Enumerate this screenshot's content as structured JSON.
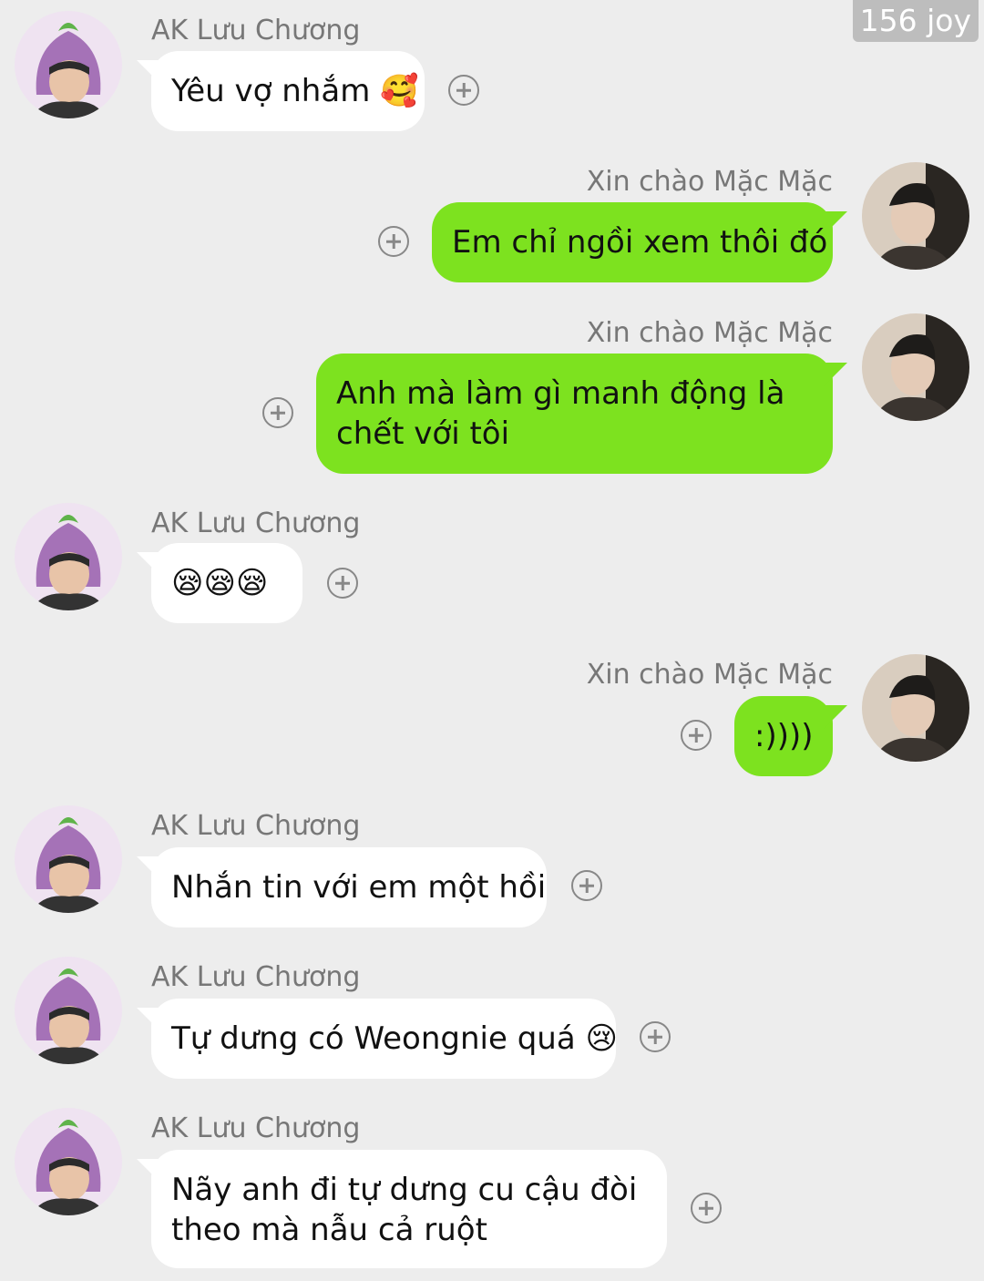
{
  "badge": {
    "label": "156 joy"
  },
  "colors": {
    "background": "#ededed",
    "outgoing_bubble": "#7de21f",
    "incoming_bubble": "#ffffff"
  },
  "contacts": {
    "them": {
      "name": "AK Lưu Chương",
      "avatar_icon": "eggplant-hat-avatar-icon"
    },
    "me": {
      "name": "Xin chào Mặc Mặc",
      "avatar_icon": "person-portrait-avatar-icon"
    }
  },
  "messages": [
    {
      "sender": "AK Lưu Chương",
      "text": "Yêu vợ nhắm 🥰",
      "direction": "incoming"
    },
    {
      "sender": "Xin chào Mặc Mặc",
      "text": "Em chỉ ngồi xem thôi đó",
      "direction": "outgoing"
    },
    {
      "sender": "Xin chào Mặc Mặc",
      "text": "Anh mà làm gì manh động là",
      "text2": "chết với tôi",
      "direction": "outgoing"
    },
    {
      "sender": "AK Lưu Chương",
      "text": "😪😪😪",
      "direction": "incoming"
    },
    {
      "sender": "Xin chào Mặc Mặc",
      "text": ":))))",
      "direction": "outgoing"
    },
    {
      "sender": "AK Lưu Chương",
      "text": "Nhắn tin với em một hồi",
      "direction": "incoming"
    },
    {
      "sender": "AK Lưu Chương",
      "text": "Tự dưng có Weongnie quá 😢",
      "direction": "incoming"
    },
    {
      "sender": "AK Lưu Chương",
      "text": "Nãy anh đi tự dưng cu cậu đòi",
      "text2": "theo mà nẫu cả ruột",
      "direction": "incoming"
    }
  ]
}
